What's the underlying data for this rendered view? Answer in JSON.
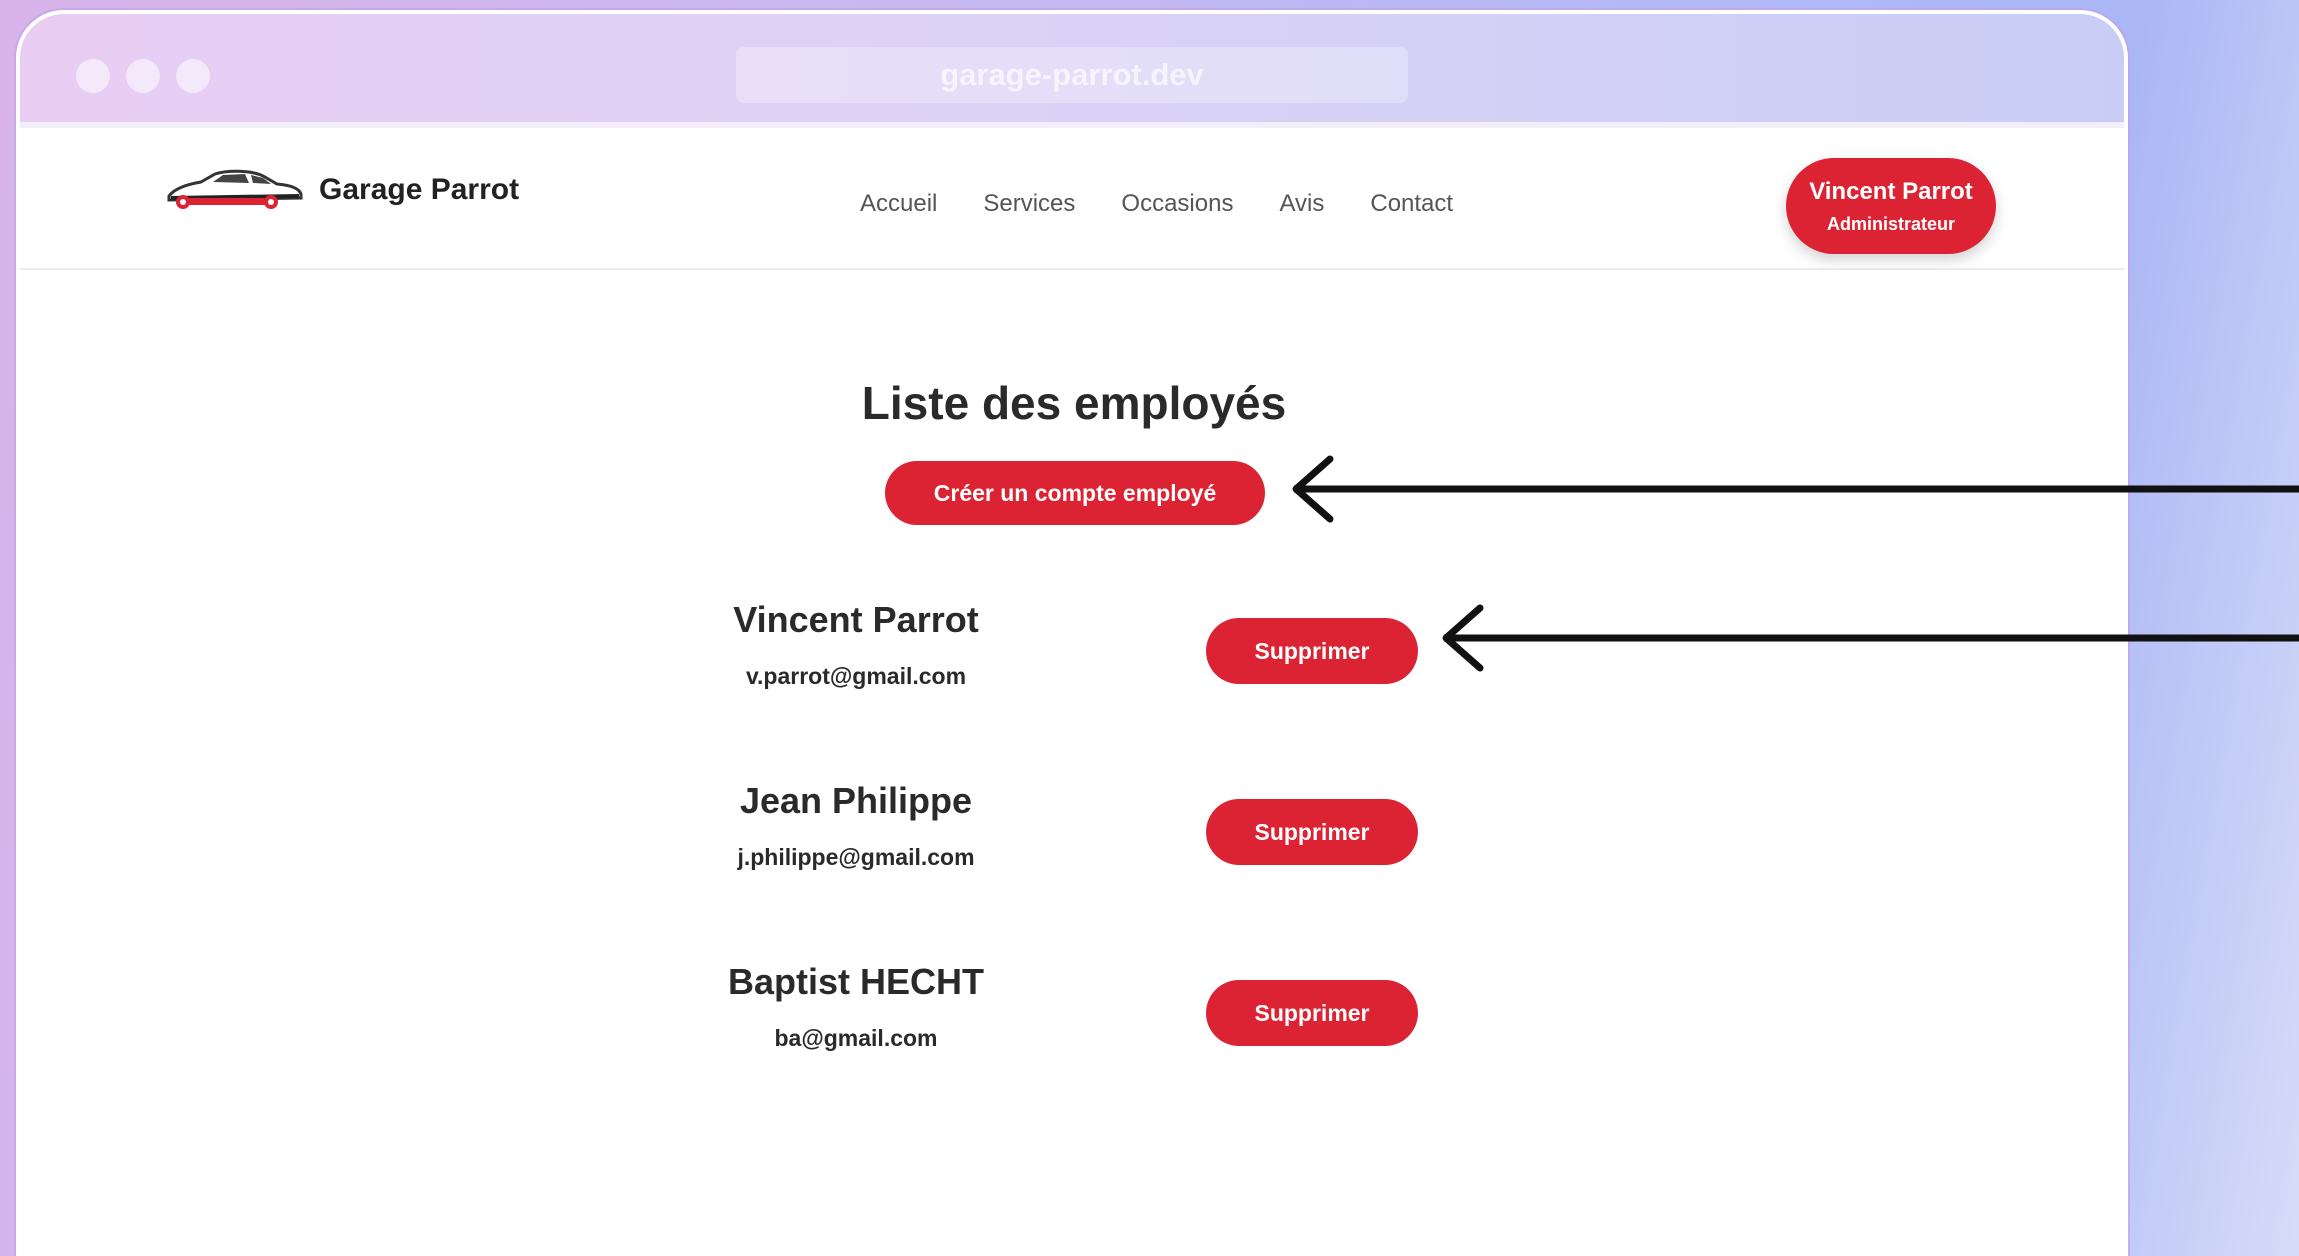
{
  "browser": {
    "url": "garage-parrot.dev"
  },
  "header": {
    "brand_name": "Garage Parrot",
    "nav": [
      "Accueil",
      "Services",
      "Occasions",
      "Avis",
      "Contact"
    ],
    "user": {
      "name": "Vincent Parrot",
      "role": "Administrateur"
    }
  },
  "main": {
    "title": "Liste des employés",
    "create_button": "Créer un compte employé",
    "employees": [
      {
        "name": "Vincent Parrot",
        "email": "v.parrot@gmail.com",
        "delete_label": "Supprimer"
      },
      {
        "name": "Jean Philippe",
        "email": "j.philippe@gmail.com",
        "delete_label": "Supprimer"
      },
      {
        "name": "Baptist HECHT",
        "email": "ba@gmail.com",
        "delete_label": "Supprimer"
      }
    ]
  },
  "colors": {
    "accent": "#dc2333",
    "text": "#2a2a2a",
    "nav_text": "#555555"
  }
}
